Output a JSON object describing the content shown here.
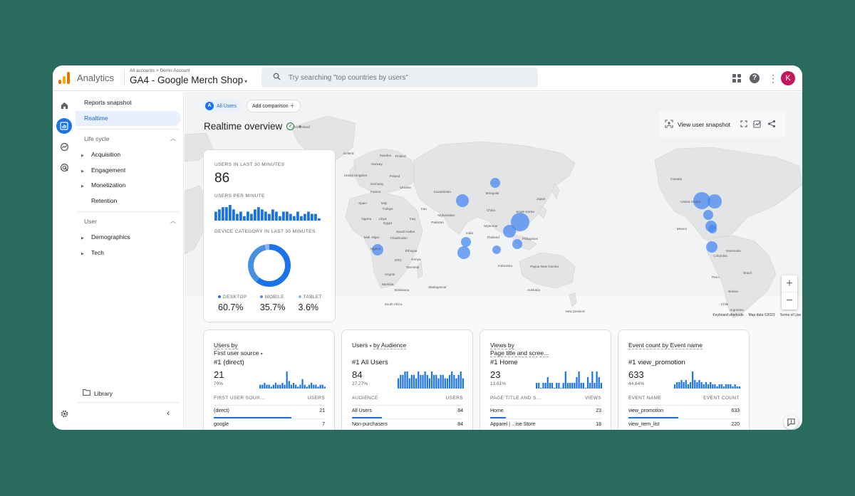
{
  "app": {
    "name": "Analytics",
    "breadcrumb": "All accounts > Demo Account",
    "property": "GA4 - Google Merch Shop"
  },
  "search": {
    "placeholder": "Try searching \"top countries by users\""
  },
  "header": {
    "avatar_letter": "K"
  },
  "sidebar": {
    "reports_snapshot": "Reports snapshot",
    "realtime": "Realtime",
    "lifecycle": "Life cycle",
    "lifecycle_items": [
      "Acquisition",
      "Engagement",
      "Monetization",
      "Retention"
    ],
    "user": "User",
    "user_items": [
      "Demographics",
      "Tech"
    ],
    "library": "Library"
  },
  "toolbar": {
    "all_users": "All Users",
    "all_users_badge": "A",
    "add_comparison": "Add comparison",
    "title": "Realtime overview",
    "view_snapshot": "View user snapshot"
  },
  "map": {
    "labels": [
      "Greenland",
      "Iceland",
      "Sweden",
      "Finland",
      "Norway",
      "United Kingdom",
      "Poland",
      "Germany",
      "France",
      "Ukraine",
      "Spain",
      "Italy",
      "Türkiye",
      "Kazakhstan",
      "Mongolia",
      "China",
      "Japan",
      "South Korea",
      "Iran",
      "Afghanistan",
      "Pakistan",
      "India",
      "Iraq",
      "Saudi Arabia",
      "Egypt",
      "Algeria",
      "Libya",
      "Mali",
      "Niger",
      "Chad",
      "Sudan",
      "Nigeria",
      "Ethiopia",
      "DRC",
      "Kenya",
      "Tanzania",
      "Angola",
      "Namibia",
      "Botswana",
      "Madagascar",
      "South Africa",
      "Myanmar",
      "Thailand",
      "Philippines",
      "Indonesia",
      "Papua New Guinea",
      "Australia",
      "New Zealand",
      "Canada",
      "United States",
      "Mexico",
      "Venezuela",
      "Colombia",
      "Peru",
      "Brazil",
      "Bolivia",
      "Chile",
      "Argentina"
    ],
    "footer": [
      "Keyboard shortcuts",
      "Map data ©2023",
      "Terms of Use"
    ]
  },
  "realtime_card": {
    "users_label": "USERS IN LAST 30 MINUTES",
    "users_value": "86",
    "per_minute_label": "USERS PER MINUTE",
    "per_minute_values": [
      4,
      5,
      6,
      6,
      7,
      5,
      3,
      4,
      2,
      4,
      3,
      5,
      6,
      5,
      4,
      3,
      5,
      4,
      2,
      4,
      4,
      3,
      2,
      4,
      2,
      3,
      4,
      3,
      3,
      1
    ],
    "device_label": "DEVICE CATEGORY IN LAST 30 MINUTES",
    "devices": [
      {
        "name": "DESKTOP",
        "value": "60.7%",
        "share": 60.7,
        "color": "#1a73e8"
      },
      {
        "name": "MOBILE",
        "value": "35.7%",
        "share": 35.7,
        "color": "#4a90e2"
      },
      {
        "name": "TABLET",
        "value": "3.6%",
        "share": 3.6,
        "color": "#8ab4f8"
      }
    ]
  },
  "cards": [
    {
      "title_a": "Users by",
      "title_b": "First user source",
      "rank": "#1 (direct)",
      "value": "21",
      "pct": "70%",
      "col_left": "FIRST USER SOUR...",
      "col_right": "USERS",
      "rows": [
        {
          "label": "(direct)",
          "value": "21",
          "share": 0.7
        },
        {
          "label": "google",
          "value": "7",
          "share": 0.23
        }
      ],
      "spark": [
        2,
        2,
        3,
        2,
        2,
        1,
        2,
        3,
        2,
        2,
        3,
        2,
        9,
        4,
        2,
        3,
        2,
        1,
        2,
        5,
        2,
        1,
        2,
        3,
        2,
        2,
        1,
        2,
        2,
        1
      ]
    },
    {
      "title_a": "Users",
      "title_b": "by Audience",
      "rank": "#1 All Users",
      "value": "84",
      "pct": "27.27%",
      "col_left": "AUDIENCE",
      "col_right": "USERS",
      "rows": [
        {
          "label": "All Users",
          "value": "84",
          "share": 0.27
        },
        {
          "label": "Non-purchasers",
          "value": "84",
          "share": 0.27
        }
      ],
      "spark": [
        3,
        4,
        4,
        5,
        5,
        3,
        4,
        4,
        3,
        5,
        4,
        4,
        5,
        4,
        3,
        5,
        4,
        4,
        3,
        4,
        4,
        3,
        3,
        4,
        5,
        4,
        3,
        4,
        5,
        3
      ]
    },
    {
      "title_a": "Views by",
      "title_b": "Page title and scree...",
      "rank": "#1 Home",
      "value": "23",
      "pct": "13.61%",
      "col_left": "PAGE TITLE AND S...",
      "col_right": "VIEWS",
      "rows": [
        {
          "label": "Home",
          "value": "23",
          "share": 0.14
        },
        {
          "label": "Apparel | ...ise Store",
          "value": "18",
          "share": 0.1
        }
      ],
      "spark": [
        1,
        1,
        0,
        1,
        1,
        2,
        1,
        1,
        0,
        1,
        1,
        0,
        1,
        3,
        1,
        1,
        1,
        1,
        2,
        3,
        1,
        1,
        0,
        2,
        1,
        3,
        1,
        3,
        2,
        1
      ]
    },
    {
      "title_a": "Event count by Event name",
      "title_b": "",
      "rank": "#1 view_promotion",
      "value": "633",
      "pct": "44.64%",
      "col_left": "EVENT NAME",
      "col_right": "EVENT COUNT",
      "rows": [
        {
          "label": "view_promotion",
          "value": "633",
          "share": 0.45
        },
        {
          "label": "view_item_list",
          "value": "220",
          "share": 0.16
        }
      ],
      "spark": [
        2,
        3,
        3,
        4,
        3,
        4,
        2,
        3,
        8,
        4,
        3,
        4,
        3,
        2,
        3,
        2,
        3,
        2,
        2,
        1,
        2,
        2,
        1,
        2,
        2,
        2,
        1,
        2,
        1,
        1
      ]
    }
  ]
}
